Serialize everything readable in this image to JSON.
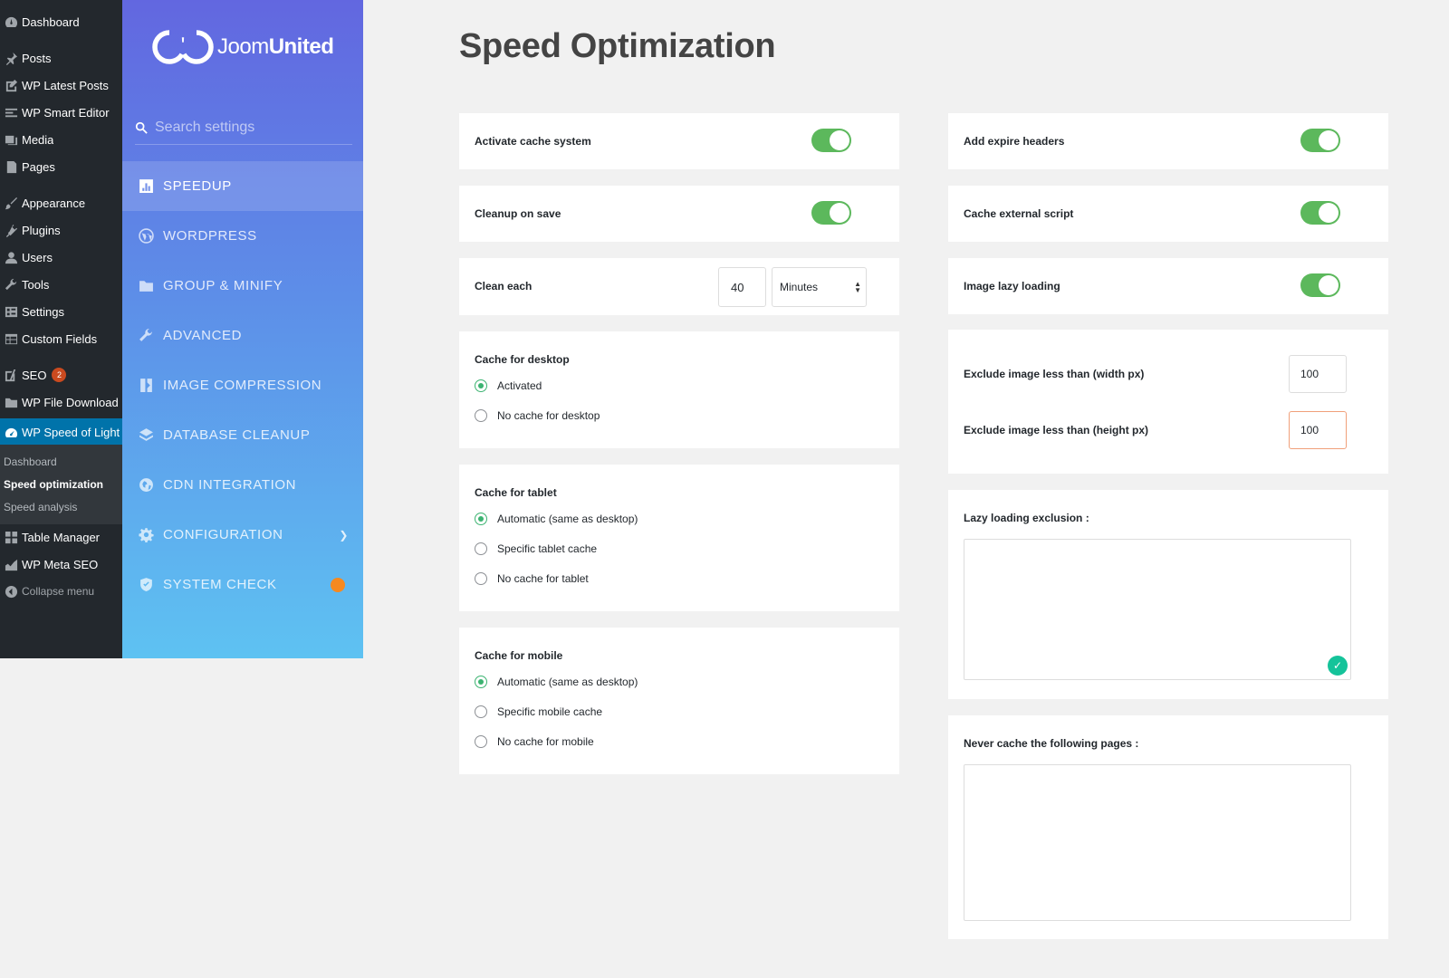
{
  "wp_menu": {
    "items": [
      {
        "label": "Dashboard",
        "icon": "dashboard-icon"
      },
      {
        "label": "Posts",
        "icon": "pin-icon"
      },
      {
        "label": "WP Latest Posts",
        "icon": "edit-icon"
      },
      {
        "label": "WP Smart Editor",
        "icon": "align-icon"
      },
      {
        "label": "Media",
        "icon": "media-icon"
      },
      {
        "label": "Pages",
        "icon": "page-icon"
      },
      {
        "label": "Appearance",
        "icon": "brush-icon"
      },
      {
        "label": "Plugins",
        "icon": "plug-icon"
      },
      {
        "label": "Users",
        "icon": "user-icon"
      },
      {
        "label": "Tools",
        "icon": "wrench-icon"
      },
      {
        "label": "Settings",
        "icon": "settings-icon"
      },
      {
        "label": "Custom Fields",
        "icon": "table-icon"
      },
      {
        "label": "SEO",
        "icon": "yoast-icon",
        "badge": "2"
      },
      {
        "label": "WP File Download",
        "icon": "folder-icon"
      },
      {
        "label": "WP Speed of Light",
        "icon": "speed-icon"
      },
      {
        "label": "Table Manager",
        "icon": "grid-icon"
      },
      {
        "label": "WP Meta SEO",
        "icon": "chart-icon"
      }
    ],
    "submenu": [
      "Dashboard",
      "Speed optimization",
      "Speed analysis"
    ],
    "collapse_label": "Collapse menu"
  },
  "plugin": {
    "logo_prefix": "Joom",
    "logo_bold": "United",
    "search_placeholder": "Search settings",
    "nav": [
      {
        "label": "SPEEDUP",
        "icon": "chart-bar-icon"
      },
      {
        "label": "WORDPRESS",
        "icon": "wordpress-icon"
      },
      {
        "label": "GROUP & MINIFY",
        "icon": "folder-icon"
      },
      {
        "label": "ADVANCED",
        "icon": "wrench-icon"
      },
      {
        "label": "IMAGE COMPRESSION",
        "icon": "image-compress-icon"
      },
      {
        "label": "DATABASE CLEANUP",
        "icon": "layers-icon"
      },
      {
        "label": "CDN INTEGRATION",
        "icon": "globe-icon"
      },
      {
        "label": "CONFIGURATION",
        "icon": "gear-icon"
      },
      {
        "label": "SYSTEM CHECK",
        "icon": "shield-check-icon"
      }
    ]
  },
  "page": {
    "title": "Speed Optimization",
    "activate_cache": "Activate cache system",
    "cleanup_on_save": "Cleanup on save",
    "clean_each": "Clean each",
    "clean_each_value": "40",
    "clean_each_unit": "Minutes",
    "cache_desktop": {
      "title": "Cache for desktop",
      "options": [
        "Activated",
        "No cache for desktop"
      ]
    },
    "cache_tablet": {
      "title": "Cache for tablet",
      "options": [
        "Automatic (same as desktop)",
        "Specific tablet cache",
        "No cache for tablet"
      ]
    },
    "cache_mobile": {
      "title": "Cache for mobile",
      "options": [
        "Automatic (same as desktop)",
        "Specific mobile cache",
        "No cache for mobile"
      ]
    },
    "expire_headers": "Add expire headers",
    "cache_external": "Cache external script",
    "lazy_loading": "Image lazy loading",
    "exclude_width_label": "Exclude image less than (width px)",
    "exclude_width_value": "100",
    "exclude_height_label": "Exclude image less than (height px)",
    "exclude_height_value": "100",
    "lazy_exclusion_label": "Lazy loading exclusion :",
    "never_cache_label": "Never cache the following pages :"
  },
  "colors": {
    "toggle_on": "#5cb85c",
    "radio_selected": "#3cb371",
    "focus_border": "#f0a07a",
    "wp_current": "#0073aa",
    "seo_badge": "#ca4a1f",
    "warning": "#f6891f"
  }
}
